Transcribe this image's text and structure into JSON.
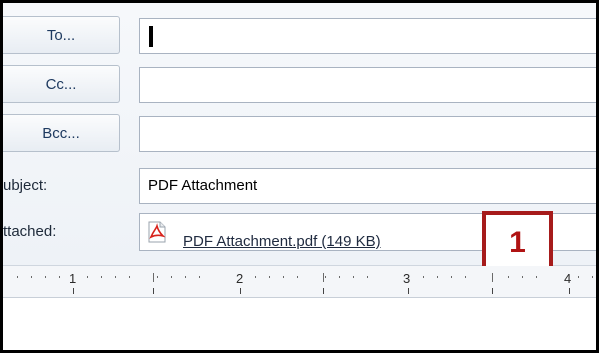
{
  "buttons": {
    "to": "To...",
    "cc": "Cc...",
    "bcc": "Bcc..."
  },
  "fields": {
    "to_value": "",
    "cc_value": "",
    "bcc_value": "",
    "subject_label": "ubject:",
    "subject_value": "PDF Attachment",
    "attached_label": "ttached:",
    "attachment_name": "PDF Attachment.pdf (149 KB)"
  },
  "callout": {
    "label": "1",
    "border_color": "#a61b1b"
  },
  "ruler": {
    "numbers": [
      "1",
      "2",
      "3",
      "4"
    ]
  },
  "icons": {
    "attachment": "pdf-file-icon"
  }
}
